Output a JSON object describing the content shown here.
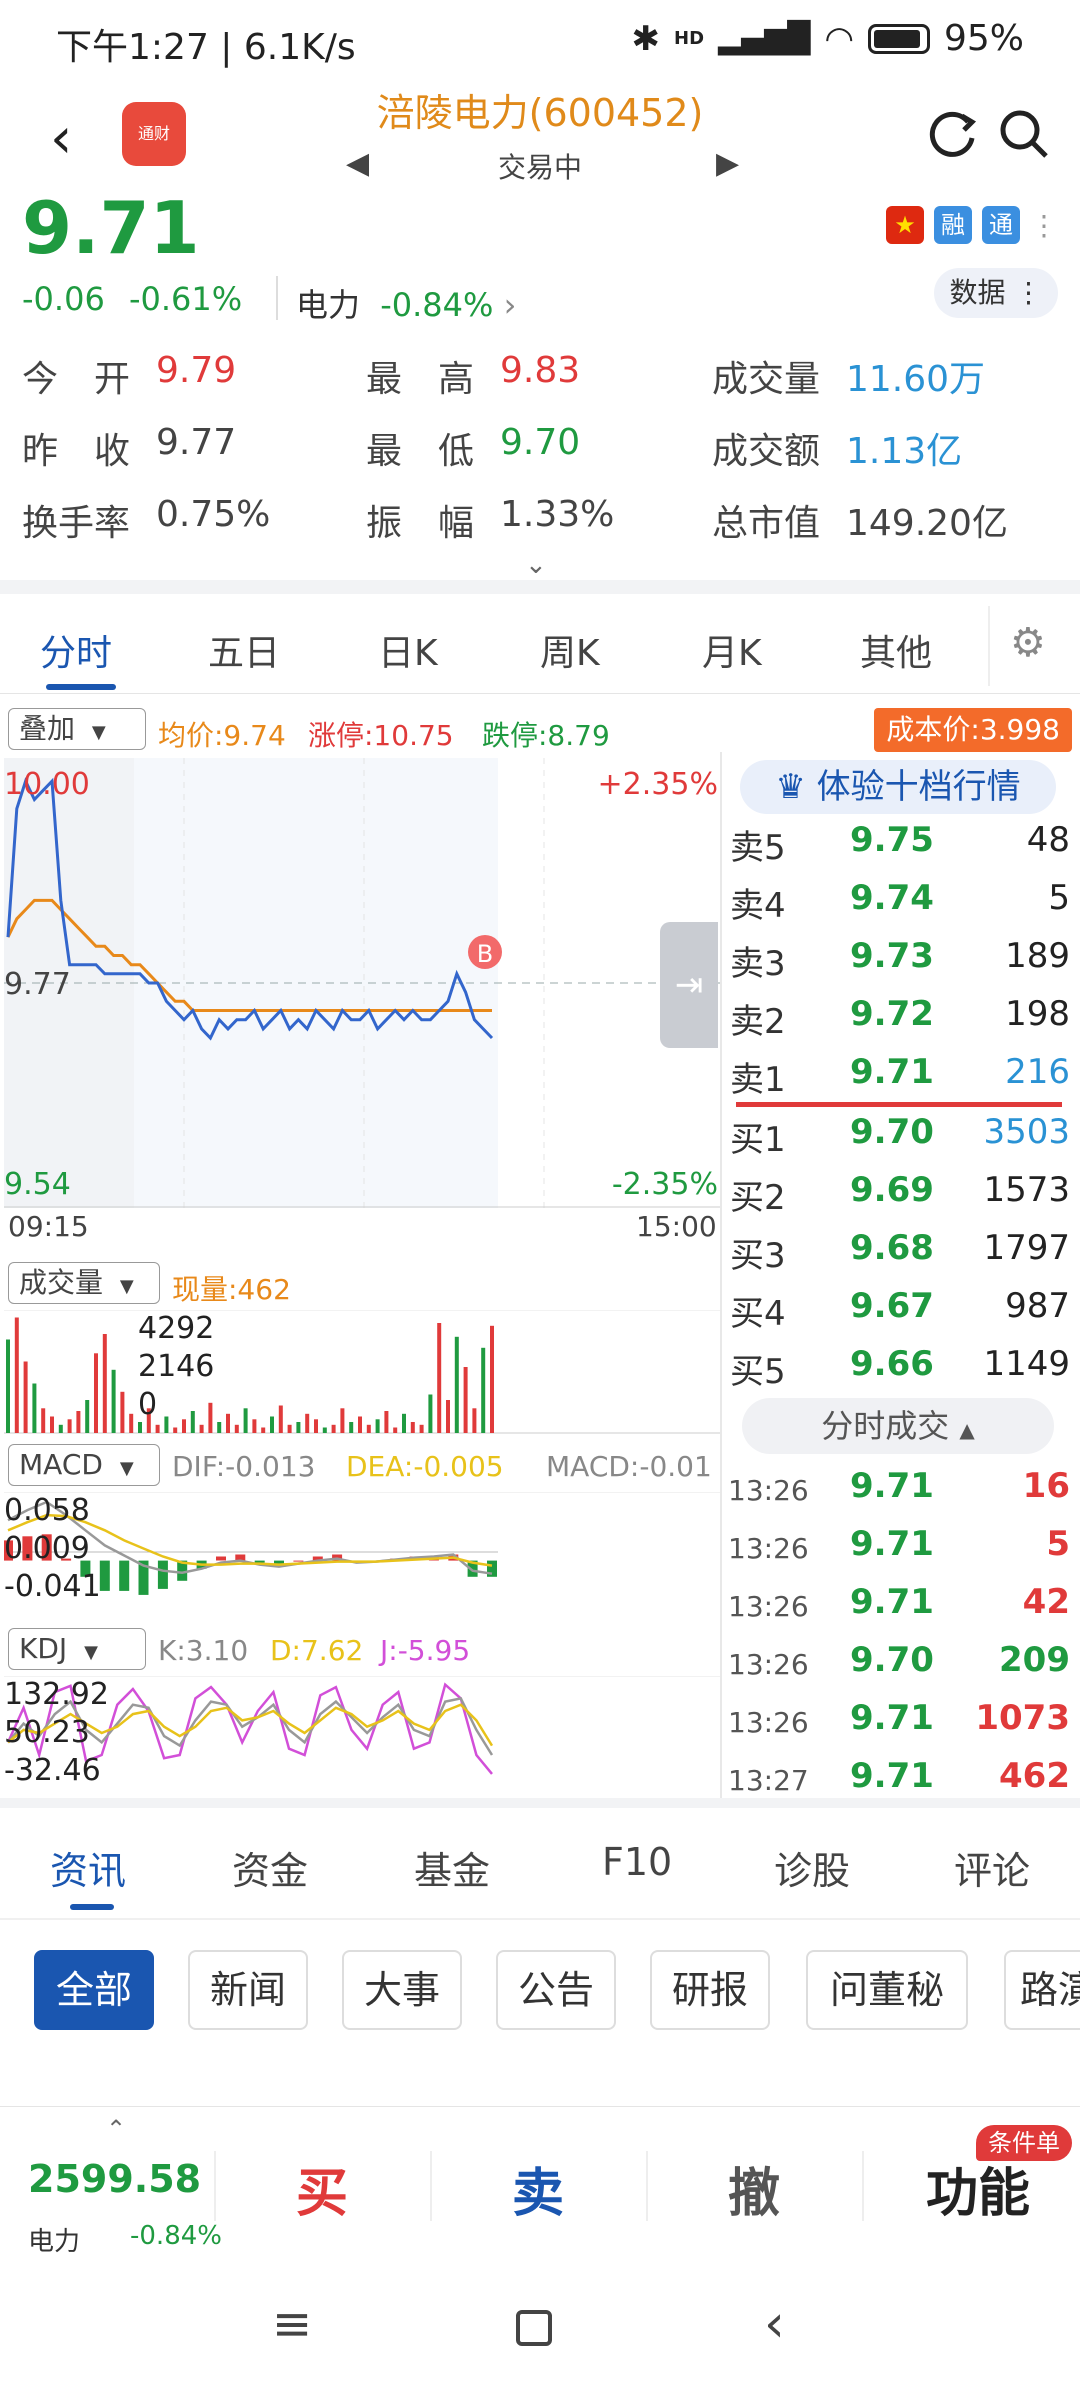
{
  "status_bar": {
    "time": "下午1:27 | 6.1K/s",
    "battery": "95%",
    "net_tag": "HD"
  },
  "header": {
    "back_icon": "chevron-left-icon",
    "app_logo_text": "通财",
    "stock_title": "涪陵电力(600452)",
    "trade_status": "交易中",
    "refresh_icon": "refresh-icon",
    "search_icon": "search-icon"
  },
  "price": {
    "last": "9.71",
    "change": "-0.06",
    "change_pct": "-0.61%",
    "sector_name": "电力",
    "sector_pct": "-0.84%",
    "badge_rong": "融",
    "badge_tong": "通",
    "data_btn": "数据"
  },
  "quote": {
    "row1": [
      {
        "label": "今　开",
        "value": "9.79",
        "color": "#e03a3a"
      },
      {
        "label": "最　高",
        "value": "9.83",
        "color": "#e03a3a"
      },
      {
        "label": "成交量",
        "value": "11.60万",
        "color": "#2a92d4"
      }
    ],
    "row2": [
      {
        "label": "昨　收",
        "value": "9.77",
        "color": "#444444"
      },
      {
        "label": "最　低",
        "value": "9.70",
        "color": "#1f9a40"
      },
      {
        "label": "成交额",
        "value": "1.13亿",
        "color": "#2a92d4"
      }
    ],
    "row3": [
      {
        "label": "换手率",
        "value": "0.75%",
        "color": "#444444"
      },
      {
        "label": "振　幅",
        "value": "1.33%",
        "color": "#444444"
      },
      {
        "label": "总市值",
        "value": "149.20亿",
        "color": "#444444"
      }
    ]
  },
  "chart_tabs": [
    "分时",
    "五日",
    "日K",
    "周K",
    "月K",
    "其他"
  ],
  "overlay": {
    "select": "叠加",
    "avg": "均价:9.74",
    "limit_up": "涨停:10.75",
    "limit_down": "跌停:8.79",
    "cost": "成本价:3.998"
  },
  "chart_data": [
    {
      "type": "line",
      "title": "",
      "x_range": [
        "09:15",
        "15:00"
      ],
      "ylim": [
        9.54,
        10.0
      ],
      "pct_range": [
        "+2.35%",
        "-2.35%"
      ],
      "prev_close": "9.77",
      "top_label": "10.00",
      "bottom_label": "9.54",
      "start_label": "09:15",
      "end_label": "15:00",
      "marker": "B",
      "series": [
        {
          "name": "",
          "values": [
            9.82,
            9.96,
            9.99,
            9.97,
            9.98,
            9.99,
            9.86,
            9.79,
            9.79,
            9.79,
            9.79,
            9.78,
            9.78,
            9.78,
            9.78,
            9.78,
            9.77,
            9.77,
            9.75,
            9.74,
            9.73,
            9.74,
            9.72,
            9.71,
            9.73,
            9.72,
            9.73,
            9.73,
            9.74,
            9.72,
            9.73,
            9.74,
            9.72,
            9.73,
            9.72,
            9.74,
            9.73,
            9.72,
            9.74,
            9.73,
            9.73,
            9.74,
            9.72,
            9.73,
            9.74,
            9.73,
            9.74,
            9.73,
            9.73,
            9.74,
            9.75,
            9.78,
            9.76,
            9.73,
            9.72,
            9.71
          ]
        },
        {
          "name": "",
          "values": [
            9.82,
            9.84,
            9.85,
            9.86,
            9.86,
            9.86,
            9.85,
            9.84,
            9.83,
            9.82,
            9.81,
            9.81,
            9.8,
            9.8,
            9.79,
            9.79,
            9.78,
            9.77,
            9.76,
            9.75,
            9.75,
            9.74,
            9.74,
            9.74,
            9.74,
            9.74,
            9.74,
            9.74,
            9.74,
            9.74,
            9.74,
            9.74,
            9.74,
            9.74,
            9.74,
            9.74,
            9.74,
            9.74,
            9.74,
            9.74,
            9.74,
            9.74,
            9.74,
            9.74,
            9.74,
            9.74,
            9.74,
            9.74,
            9.74,
            9.74,
            9.74,
            9.74,
            9.74,
            9.74,
            9.74,
            9.74
          ]
        }
      ]
    },
    {
      "type": "bar",
      "title": "",
      "ylim": [
        0,
        4292
      ],
      "ticks": [
        "4292",
        "2146",
        "0"
      ],
      "values": [
        3400,
        4200,
        2600,
        1800,
        900,
        600,
        300,
        500,
        800,
        1200,
        2900,
        3600,
        2300,
        1500,
        700,
        400,
        900,
        300,
        600,
        200,
        500,
        800,
        300,
        1100,
        400,
        700,
        300,
        900,
        500,
        200,
        600,
        1000,
        300,
        400,
        700,
        500,
        200,
        300,
        900,
        400,
        600,
        300,
        500,
        800,
        200,
        700,
        400,
        300,
        1400,
        4000,
        1200,
        3500,
        2400,
        900,
        3100,
        3900
      ]
    },
    {
      "type": "line",
      "title": "",
      "ticks": [
        "0.058",
        "0.009",
        "-0.041"
      ],
      "series": [
        {
          "name": "",
          "values": [
            0.04,
            0.05,
            0.058,
            0.045,
            0.03,
            0.015,
            0.005,
            -0.005,
            -0.01,
            -0.012,
            -0.008,
            -0.002,
            0.0,
            -0.004,
            -0.006,
            -0.003,
            0.0,
            0.002,
            -0.002,
            -0.001,
            0.001,
            0.003,
            0.004,
            0.006,
            -0.01,
            -0.013
          ]
        },
        {
          "name": "",
          "values": [
            0.03,
            0.038,
            0.045,
            0.044,
            0.038,
            0.03,
            0.02,
            0.012,
            0.004,
            -0.002,
            -0.004,
            -0.004,
            -0.003,
            -0.003,
            -0.004,
            -0.003,
            -0.002,
            -0.001,
            -0.001,
            -0.001,
            0.0,
            0.001,
            0.002,
            0.003,
            -0.002,
            -0.005
          ]
        }
      ]
    },
    {
      "type": "line",
      "title": "",
      "ticks": [
        "132.92",
        "50.23",
        "-32.46"
      ],
      "series": [
        {
          "name": "",
          "values": [
            40,
            95,
            20,
            120,
            130,
            10,
            20,
            100,
            125,
            90,
            15,
            20,
            110,
            128,
            100,
            40,
            90,
            120,
            30,
            20,
            115,
            128,
            60,
            30,
            100,
            120,
            30,
            40,
            132,
            110,
            20,
            -10
          ]
        },
        {
          "name": "",
          "values": [
            40,
            70,
            50,
            85,
            105,
            60,
            40,
            70,
            100,
            95,
            50,
            35,
            75,
            105,
            100,
            65,
            80,
            100,
            60,
            40,
            85,
            105,
            80,
            55,
            80,
            100,
            60,
            50,
            105,
            110,
            60,
            20
          ]
        },
        {
          "name": "",
          "values": [
            40,
            60,
            55,
            70,
            85,
            70,
            55,
            65,
            85,
            90,
            65,
            50,
            65,
            90,
            95,
            75,
            80,
            90,
            70,
            55,
            75,
            95,
            85,
            65,
            75,
            90,
            70,
            60,
            90,
            100,
            75,
            35
          ]
        }
      ]
    }
  ],
  "volume_pane": {
    "select": "成交量",
    "now": "现量:462"
  },
  "macd_pane": {
    "select": "MACD",
    "dif": "DIF:-0.013",
    "dea": "DEA:-0.005",
    "macd": "MACD:-0.01"
  },
  "kdj_pane": {
    "select": "KDJ",
    "k": "K:3.10",
    "d": "D:7.62",
    "j": "J:-5.95"
  },
  "order_book": {
    "premium_btn": "体验十档行情",
    "asks": [
      {
        "label": "卖5",
        "price": "9.75",
        "vol": "48",
        "vol_color": "#222222"
      },
      {
        "label": "卖4",
        "price": "9.74",
        "vol": "5",
        "vol_color": "#222222"
      },
      {
        "label": "卖3",
        "price": "9.73",
        "vol": "189",
        "vol_color": "#222222"
      },
      {
        "label": "卖2",
        "price": "9.72",
        "vol": "198",
        "vol_color": "#222222"
      },
      {
        "label": "卖1",
        "price": "9.71",
        "vol": "216",
        "vol_color": "#2a92d4"
      }
    ],
    "bids": [
      {
        "label": "买1",
        "price": "9.70",
        "vol": "3503",
        "vol_color": "#2a92d4"
      },
      {
        "label": "买2",
        "price": "9.69",
        "vol": "1573",
        "vol_color": "#222222"
      },
      {
        "label": "买3",
        "price": "9.68",
        "vol": "1797",
        "vol_color": "#222222"
      },
      {
        "label": "买4",
        "price": "9.67",
        "vol": "987",
        "vol_color": "#222222"
      },
      {
        "label": "买5",
        "price": "9.66",
        "vol": "1149",
        "vol_color": "#222222"
      }
    ],
    "ticks_btn": "分时成交",
    "trades": [
      {
        "time": "13:26",
        "price": "9.71",
        "vol": "16",
        "color": "#e03a3a"
      },
      {
        "time": "13:26",
        "price": "9.71",
        "vol": "5",
        "color": "#e03a3a"
      },
      {
        "time": "13:26",
        "price": "9.71",
        "vol": "42",
        "color": "#e03a3a"
      },
      {
        "time": "13:26",
        "price": "9.70",
        "vol": "209",
        "color": "#1f9a40"
      },
      {
        "time": "13:26",
        "price": "9.71",
        "vol": "1073",
        "color": "#e03a3a"
      },
      {
        "time": "13:27",
        "price": "9.71",
        "vol": "462",
        "color": "#e03a3a"
      }
    ]
  },
  "news_tabs": [
    "资讯",
    "资金",
    "基金",
    "F10",
    "诊股",
    "评论"
  ],
  "chips": [
    "全部",
    "新闻",
    "大事",
    "公告",
    "研报",
    "问董秘",
    "路演"
  ],
  "action_bar": {
    "index_value": "2599.58",
    "index_name": "电力",
    "index_pct": "-0.84%",
    "buy": "买",
    "sell": "卖",
    "cancel": "撤",
    "func": "功能",
    "func_tag": "条件单"
  },
  "colors": {
    "up": "#e03a3a",
    "down": "#1f9a40",
    "accent": "#1a56b0",
    "price_line": "#3366cc",
    "avg_line": "#e8891a"
  }
}
